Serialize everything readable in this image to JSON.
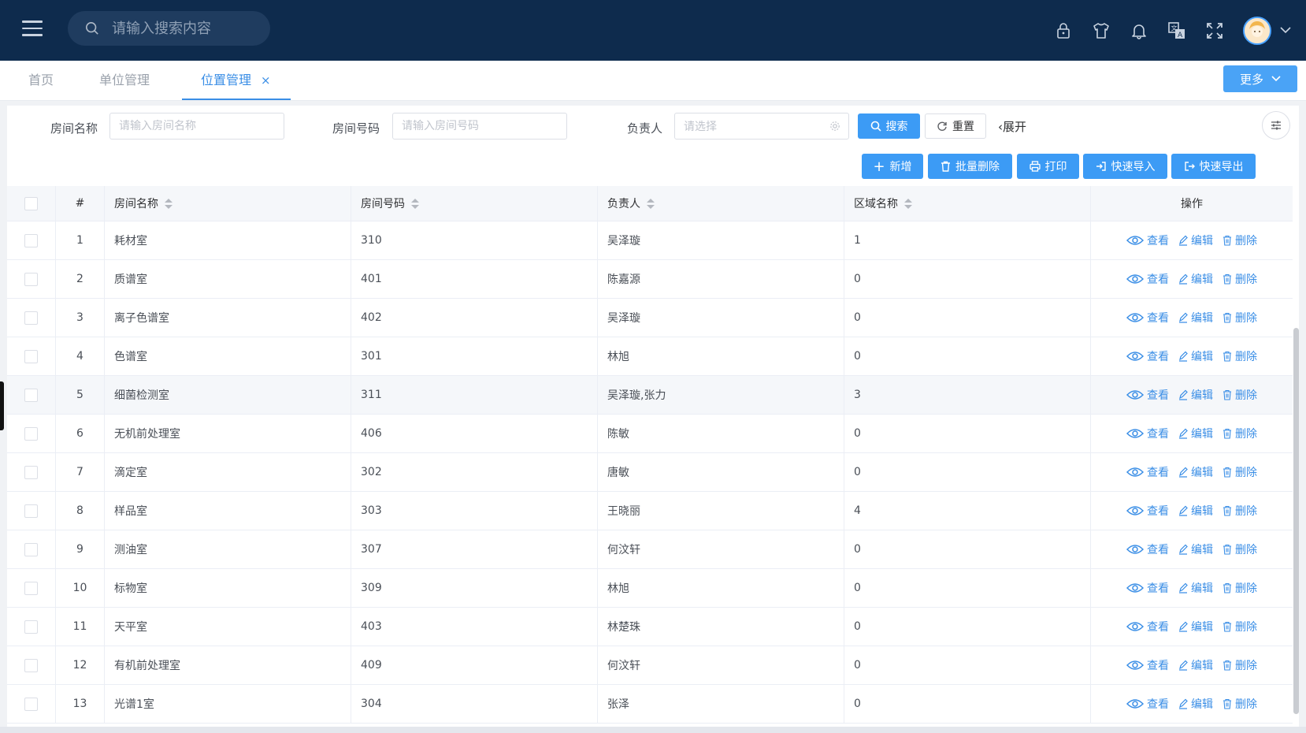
{
  "header": {
    "search_placeholder": "请输入搜索内容",
    "icons": [
      "lock-icon",
      "shirt-icon",
      "bell-icon",
      "translate-icon",
      "fullscreen-icon"
    ]
  },
  "tabs": [
    {
      "label": "首页"
    },
    {
      "label": "单位管理"
    },
    {
      "label": "位置管理",
      "active": true
    }
  ],
  "tab_close": "×",
  "more_button": "更多",
  "filters": {
    "room_name_label": "房间名称",
    "room_name_placeholder": "请输入房间名称",
    "room_code_label": "房间号码",
    "room_code_placeholder": "请输入房间号码",
    "owner_label": "负责人",
    "owner_placeholder": "请选择",
    "search_btn": "搜索",
    "reset_btn": "重置",
    "expand_link": "展开"
  },
  "toolbar": {
    "add": "新增",
    "batch_delete": "批量删除",
    "print": "打印",
    "quick_import": "快速导入",
    "quick_export": "快速导出"
  },
  "table": {
    "columns": {
      "index": "#",
      "name": "房间名称",
      "code": "房间号码",
      "owner": "负责人",
      "area": "区域名称",
      "ops": "操作"
    },
    "op_labels": {
      "view": "查看",
      "edit": "编辑",
      "delete": "删除"
    },
    "rows": [
      {
        "idx": "1",
        "name": "耗材室",
        "code": "310",
        "owner": "吴泽璇",
        "area": "1"
      },
      {
        "idx": "2",
        "name": "质谱室",
        "code": "401",
        "owner": "陈嘉源",
        "area": "0"
      },
      {
        "idx": "3",
        "name": "离子色谱室",
        "code": "402",
        "owner": "吴泽璇",
        "area": "0"
      },
      {
        "idx": "4",
        "name": "色谱室",
        "code": "301",
        "owner": "林旭",
        "area": "0"
      },
      {
        "idx": "5",
        "name": "细菌检测室",
        "code": "311",
        "owner": "吴泽璇,张力",
        "area": "3"
      },
      {
        "idx": "6",
        "name": "无机前处理室",
        "code": "406",
        "owner": "陈敏",
        "area": "0"
      },
      {
        "idx": "7",
        "name": "滴定室",
        "code": "302",
        "owner": "唐敏",
        "area": "0"
      },
      {
        "idx": "8",
        "name": "样品室",
        "code": "303",
        "owner": "王晓丽",
        "area": "4"
      },
      {
        "idx": "9",
        "name": "测油室",
        "code": "307",
        "owner": "何汶轩",
        "area": "0"
      },
      {
        "idx": "10",
        "name": "标物室",
        "code": "309",
        "owner": "林旭",
        "area": "0"
      },
      {
        "idx": "11",
        "name": "天平室",
        "code": "403",
        "owner": "林楚珠",
        "area": "0"
      },
      {
        "idx": "12",
        "name": "有机前处理室",
        "code": "409",
        "owner": "何汶轩",
        "area": "0"
      },
      {
        "idx": "13",
        "name": "光谱1室",
        "code": "304",
        "owner": "张泽",
        "area": "0"
      }
    ]
  },
  "colors": {
    "header_bg": "#0e2b4d",
    "primary": "#3c9bf5",
    "link": "#3a8ee6"
  }
}
